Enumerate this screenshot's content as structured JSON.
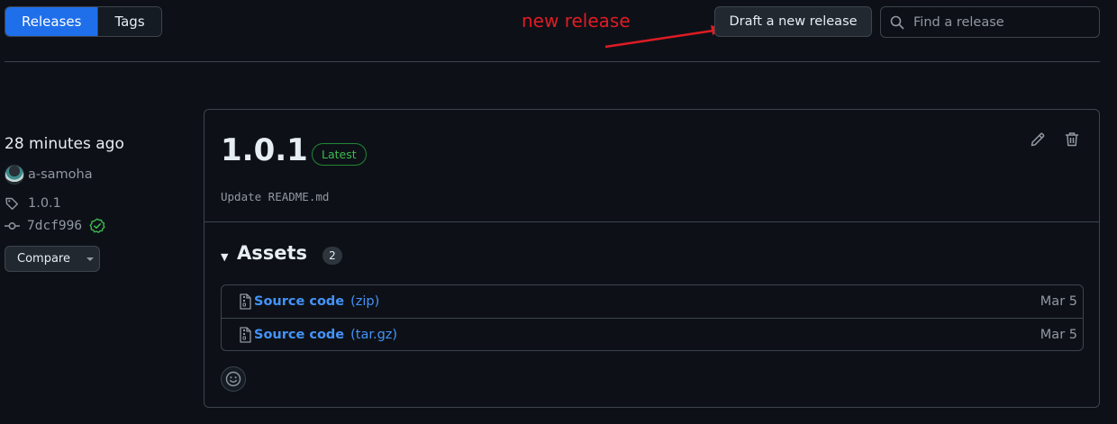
{
  "tabs": [
    {
      "label": "Releases",
      "active": true
    },
    {
      "label": "Tags",
      "active": false
    }
  ],
  "annotation": {
    "text": "new release",
    "color": "#e01b24"
  },
  "toolbar": {
    "draft_label": "Draft a new release",
    "search_placeholder": "Find a release"
  },
  "release_meta": {
    "time": "28 minutes ago",
    "author": "a-samoha",
    "tag": "1.0.1",
    "commit": "7dcf996",
    "compare_label": "Compare"
  },
  "release": {
    "version": "1.0.1",
    "badge": "Latest",
    "commit_message": "Update README.md"
  },
  "assets": {
    "title": "Assets",
    "count": "2",
    "items": [
      {
        "name": "Source code",
        "ext": "(zip)",
        "date": "Mar 5"
      },
      {
        "name": "Source code",
        "ext": "(tar.gz)",
        "date": "Mar 5"
      }
    ]
  },
  "colors": {
    "accent": "#1f6feb",
    "link": "#4493f8",
    "success": "#3fb950",
    "background": "#0d1117"
  }
}
